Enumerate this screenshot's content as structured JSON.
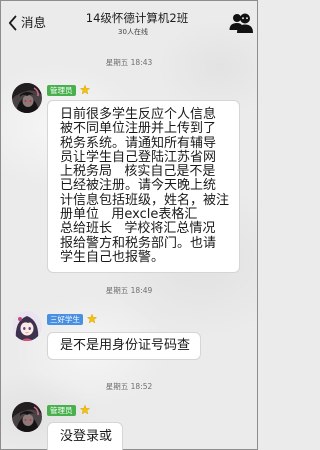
{
  "header": {
    "back_label": "消息",
    "back_icon": "chevron-left-icon",
    "title": "14级怀德计算机2班",
    "subtitle": "30人在线",
    "group_icon": "group-members-icon"
  },
  "messages": [
    {
      "timestamp": "星期五 18:43",
      "sender_badge": "管理员",
      "badge_color": "#48b04c",
      "badge_icon": "star-icon",
      "text": "日前很多学生反应个人信息\n被不同单位注册并上传到了\n税务系统。请通知所有辅导\n员让学生自己登陆江苏省网\n上税务局   核实自己是不是\n已经被注册。请今天晚上统\n计信息包括班级，姓名，被注\n册单位   用excle表格汇\n总给班长   学校将汇总情况\n报给警方和税务部门。也请\n学生自己也报警。"
    },
    {
      "timestamp": "星期五 18:49",
      "sender_badge": "三好学生",
      "badge_color": "#4a90e2",
      "badge_icon": "star-icon",
      "text": "是不是用身份证号码查"
    },
    {
      "timestamp": "星期五 18:52",
      "sender_badge": "管理员",
      "badge_color": "#48b04c",
      "badge_icon": "star-icon",
      "text": "没登录或"
    }
  ],
  "colors": {
    "background": "#ebebeb",
    "bubble": "#ffffff",
    "bubble_border": "#d5d5d5",
    "text": "#1a1a1a",
    "timestamp": "#6f6f6f",
    "star": "#f4c20d"
  }
}
